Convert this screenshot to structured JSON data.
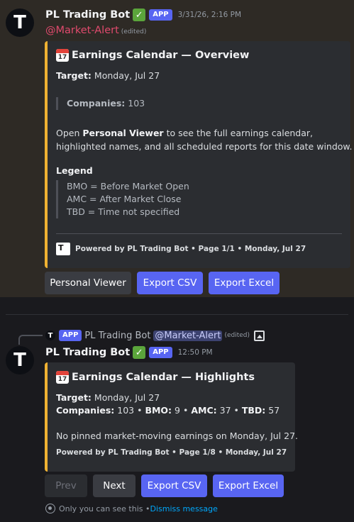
{
  "message1": {
    "username": "PL Trading Bot",
    "verified": "✓",
    "app_badge": "APP",
    "timestamp": "3/31/26, 2:16 PM",
    "mention": "@Market-Alert",
    "edited": "(edited)",
    "embed": {
      "accent_color": "#f0b232",
      "calendar_icon_text": "17",
      "title": "Earnings Calendar — Overview",
      "target_label": "Target:",
      "target_value": "Monday, Jul 27",
      "companies_label": "Companies:",
      "companies_value": "103",
      "open_prefix": "Open ",
      "open_bold": "Personal Viewer",
      "open_suffix": " to see the full earnings calendar,",
      "open_line2": "highlighted names, and all scheduled reports for this date window.",
      "legend_title": "Legend",
      "legend_items": [
        "BMO = Before Market Open",
        "AMC = After Market Close",
        "TBD = Time not specified"
      ],
      "footer_icon_text": "T",
      "footer": "Powered by PL Trading Bot • Page 1/1 • Monday, Jul 27"
    },
    "buttons": [
      "Personal Viewer",
      "Export CSV",
      "Export Excel"
    ]
  },
  "message2": {
    "reply": {
      "app_badge": "APP",
      "username": "PL Trading Bot",
      "mention": "@Market-Alert",
      "edited": "(edited)",
      "image_icon": "image-icon"
    },
    "username": "PL Trading Bot",
    "verified": "✓",
    "app_badge": "APP",
    "timestamp": "12:50 PM",
    "embed": {
      "calendar_icon_text": "17",
      "title": "Earnings Calendar — Highlights",
      "target_label": "Target:",
      "target_value": "Monday, Jul 27",
      "companies_label": "Companies:",
      "companies_value": "103",
      "bmo_label": "BMO:",
      "bmo_value": "9",
      "amc_label": "AMC:",
      "amc_value": "37",
      "tbd_label": "TBD:",
      "tbd_value": "57",
      "separator": "•",
      "note": "No pinned market-moving earnings on Monday, Jul 27.",
      "footer": "Powered by PL Trading Bot • Page 1/8 • Monday, Jul 27"
    },
    "buttons": [
      "Prev",
      "Next",
      "Export CSV",
      "Export Excel"
    ],
    "ephemeral_text": "Only you can see this • ",
    "dismiss_label": "Dismiss message"
  },
  "avatar_letter": "T",
  "colors": {
    "accent": "#5865f2",
    "embed_bar": "#f0b232",
    "mention": "#e04a6d",
    "link": "#00a8fc"
  }
}
